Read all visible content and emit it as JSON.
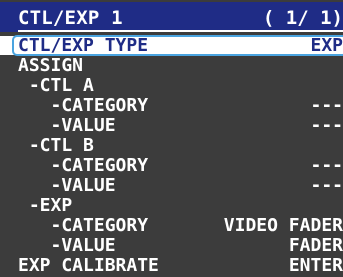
{
  "header": {
    "title": "CTL/EXP 1",
    "page": "( 1/ 1)"
  },
  "menu": {
    "items": [
      {
        "label": "CTL/EXP TYPE",
        "value": "EXP",
        "selected": true
      },
      {
        "label": "ASSIGN",
        "value": ""
      },
      {
        "label": " -CTL A",
        "value": ""
      },
      {
        "label": "   -CATEGORY",
        "value": "---"
      },
      {
        "label": "   -VALUE",
        "value": "---"
      },
      {
        "label": " -CTL B",
        "value": ""
      },
      {
        "label": "   -CATEGORY",
        "value": "---"
      },
      {
        "label": "   -VALUE",
        "value": "---"
      },
      {
        "label": " -EXP",
        "value": ""
      },
      {
        "label": "   -CATEGORY",
        "value": "VIDEO FADER"
      },
      {
        "label": "   -VALUE",
        "value": "FADER"
      },
      {
        "label": "EXP CALIBRATE",
        "value": "ENTER"
      }
    ]
  },
  "colors": {
    "background": "#3c3c3c",
    "title_bar": "#1f2c86",
    "selection_border": "#4aa4e0",
    "text": "#ffffff"
  }
}
